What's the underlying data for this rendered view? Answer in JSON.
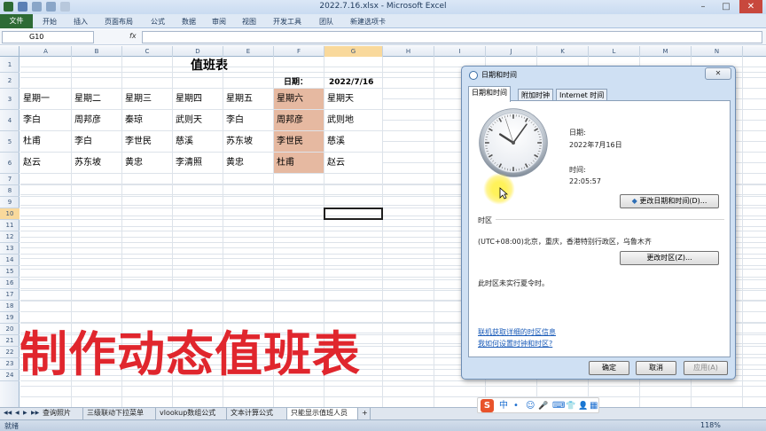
{
  "window": {
    "title": "2022.7.16.xlsx - Microsoft Excel",
    "minimize": "–",
    "maximize": "□",
    "close": "✕"
  },
  "ribbon": {
    "file": "文件",
    "tabs": [
      "开始",
      "插入",
      "页面布局",
      "公式",
      "数据",
      "审阅",
      "视图",
      "开发工具",
      "团队",
      "新建选项卡"
    ]
  },
  "formula_bar": {
    "name_box": "G10",
    "fx": "fx",
    "value": ""
  },
  "columns": [
    "A",
    "B",
    "C",
    "D",
    "E",
    "F",
    "G",
    "H",
    "I",
    "J",
    "K",
    "L",
    "M",
    "N"
  ],
  "selected_column": "G",
  "rows": [
    "1",
    "2",
    "3",
    "4",
    "5",
    "6",
    "7",
    "8",
    "9",
    "10",
    "11",
    "12",
    "13",
    "14",
    "15",
    "16",
    "17",
    "18",
    "19",
    "20",
    "21",
    "22",
    "23",
    "24"
  ],
  "selected_row": "10",
  "sheet": {
    "title": "值班表",
    "date_label": "日期：",
    "date_value": "2022/7/16",
    "table": [
      [
        "星期一",
        "星期二",
        "星期三",
        "星期四",
        "星期五",
        "星期六",
        "星期天"
      ],
      [
        "李白",
        "周邦彦",
        "秦琼",
        "武则天",
        "李白",
        "周邦彦",
        "武则地"
      ],
      [
        "杜甫",
        "李白",
        "李世民",
        "慈溪",
        "苏东坡",
        "李世民",
        "慈溪"
      ],
      [
        "赵云",
        "苏东坡",
        "黄忠",
        "李清照",
        "黄忠",
        "杜甫",
        "赵云"
      ]
    ],
    "highlight_column_index": 5,
    "highlight_color": "#e6b9a1"
  },
  "overlay_title": "制作动态值班表",
  "overlay_color": "#e0262d",
  "sheet_tabs": [
    "查询照片",
    "三级联动下拉菜单",
    "vlookup数组公式",
    "文本计算公式",
    "只能显示值班人员"
  ],
  "active_sheet_tab": "只能显示值班人员",
  "status_bar": {
    "ready": "就绪",
    "zoom": "118%"
  },
  "ime": {
    "logo": "S",
    "mode": "中",
    "items": [
      "•",
      "☺",
      "🎤",
      "⌨",
      "👕",
      "👤",
      "▦"
    ]
  },
  "dialog": {
    "title": "日期和时间",
    "close_label": "✕",
    "tabs": [
      "日期和时间",
      "附加时钟",
      "Internet 时间"
    ],
    "active_tab": "日期和时间",
    "date_label": "日期:",
    "date_value": "2022年7月16日",
    "time_label": "时间:",
    "time_value": "22:05:57",
    "change_datetime_button": "更改日期和时间(D)...",
    "timezone_heading": "时区",
    "timezone_value": "(UTC+08:00)北京，重庆，香港特别行政区，乌鲁木齐",
    "change_timezone_button": "更改时区(Z)...",
    "dst_note": "此时区未实行夏令时。",
    "link_timezone_info": "联机获取详细的时区信息",
    "link_how_to": "我如何设置时钟和时区?",
    "ok_button": "确定",
    "cancel_button": "取消",
    "apply_button": "应用(A)",
    "clock": {
      "hour": 22,
      "minute": 5,
      "second": 57
    }
  }
}
